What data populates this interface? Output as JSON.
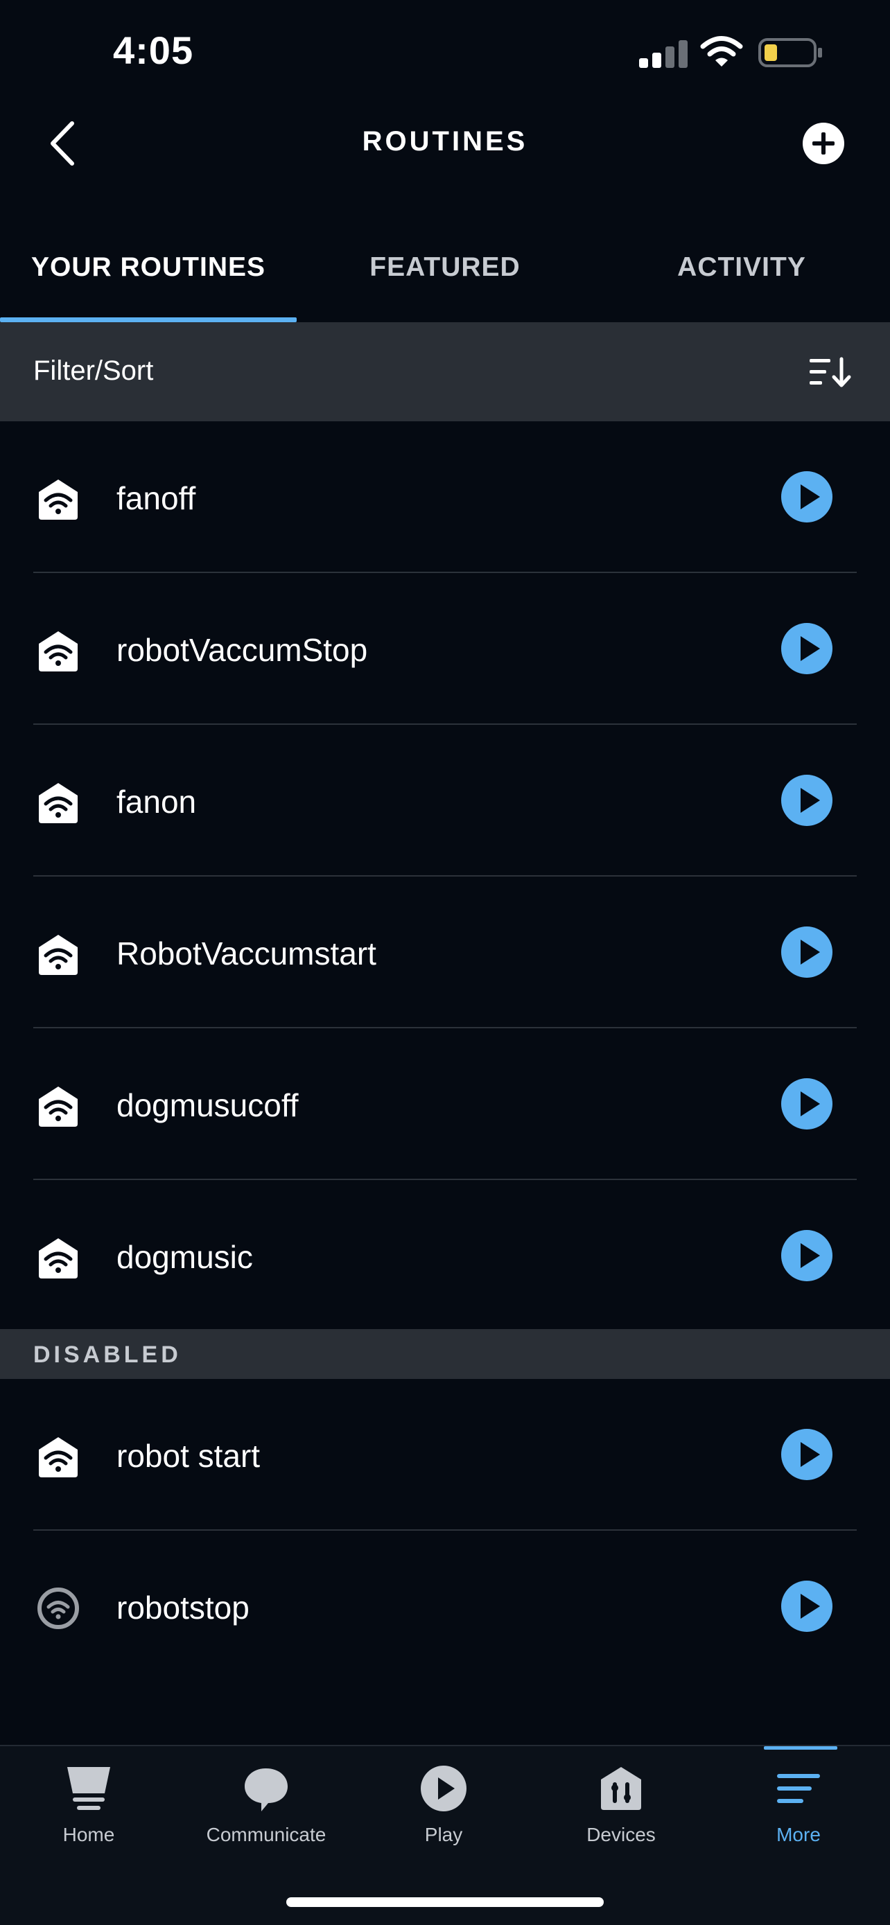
{
  "status_bar": {
    "time": "4:05",
    "icons": [
      "signal-icon",
      "wifi-icon",
      "battery-icon"
    ],
    "battery_color": "#F2D04B"
  },
  "header": {
    "title": "ROUTINES",
    "back_icon": "chevron-left-icon",
    "add_icon": "plus-circle-icon"
  },
  "tabs": [
    {
      "label": "YOUR ROUTINES",
      "active": true
    },
    {
      "label": "FEATURED",
      "active": false
    },
    {
      "label": "ACTIVITY",
      "active": false
    }
  ],
  "filter_bar": {
    "label": "Filter/Sort",
    "icon": "sort-icon"
  },
  "routines": [
    {
      "name": "fanoff",
      "icon": "smart-home-wifi-icon"
    },
    {
      "name": "robotVaccumStop",
      "icon": "smart-home-wifi-icon"
    },
    {
      "name": "fanon",
      "icon": "smart-home-wifi-icon"
    },
    {
      "name": "RobotVaccumstart",
      "icon": "smart-home-wifi-icon"
    },
    {
      "name": "dogmusucoff",
      "icon": "smart-home-wifi-icon"
    },
    {
      "name": "dogmusic",
      "icon": "smart-home-wifi-icon"
    }
  ],
  "disabled_section": {
    "label": "DISABLED",
    "routines": [
      {
        "name": "robot start",
        "icon": "smart-home-wifi-icon"
      },
      {
        "name": "robotstop",
        "icon": "echo-device-icon"
      }
    ]
  },
  "bottom_nav": [
    {
      "label": "Home",
      "icon": "home-icon",
      "active": false
    },
    {
      "label": "Communicate",
      "icon": "chat-bubble-icon",
      "active": false
    },
    {
      "label": "Play",
      "icon": "play-circle-icon",
      "active": false
    },
    {
      "label": "Devices",
      "icon": "devices-icon",
      "active": false
    },
    {
      "label": "More",
      "icon": "menu-lines-icon",
      "active": true
    }
  ],
  "colors": {
    "background": "#050A12",
    "accent": "#5CB1F2",
    "section_bg": "#2A2F36",
    "muted_text": "#C7CBD1"
  }
}
